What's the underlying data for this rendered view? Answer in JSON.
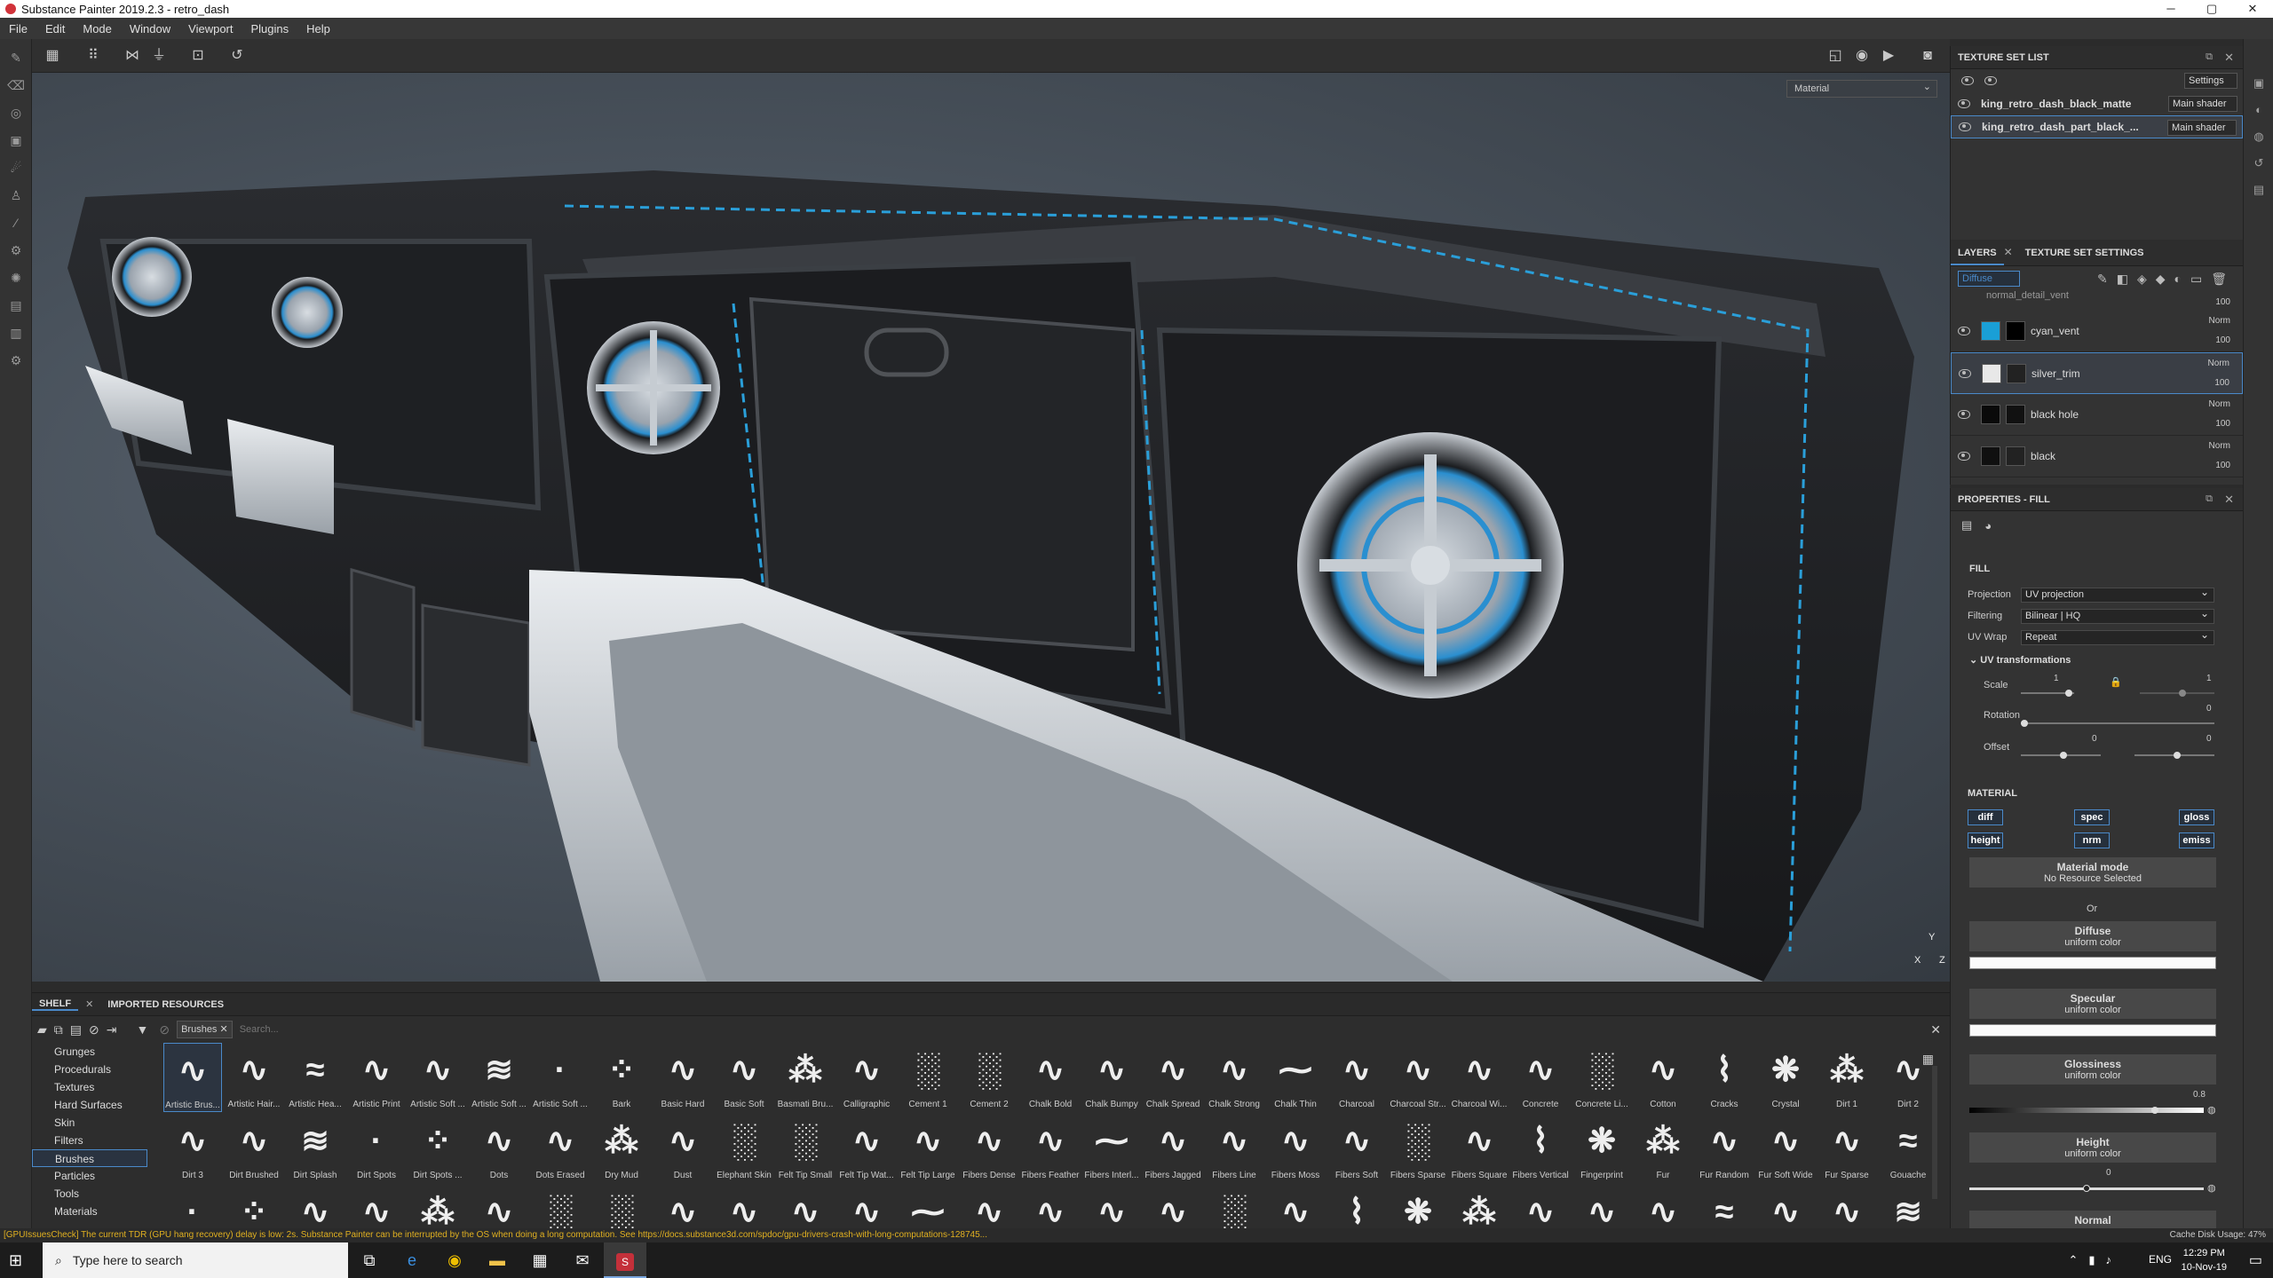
{
  "window": {
    "title": "Substance Painter 2019.2.3 - retro_dash",
    "btn_min": "─",
    "btn_max": "▢",
    "btn_close": "✕"
  },
  "menu": [
    "File",
    "Edit",
    "Mode",
    "Window",
    "Viewport",
    "Plugins",
    "Help"
  ],
  "viewport": {
    "material_mode": "Material",
    "axis_y": "Y",
    "axis_x": "X",
    "axis_z": "Z"
  },
  "texture_set_list": {
    "title": "TEXTURE SET LIST",
    "settings": "Settings",
    "sets": [
      {
        "name": "king_retro_dash_black_matte",
        "shader": "Main shader"
      },
      {
        "name": "king_retro_dash_part_black_...",
        "shader": "Main shader"
      }
    ]
  },
  "layers": {
    "tab_layers": "LAYERS",
    "tab_tss": "TEXTURE SET SETTINGS",
    "channel": "Diffuse",
    "partial_name": "normal_detail_vent",
    "partial_opacity": "100",
    "items": [
      {
        "name": "cyan_vent",
        "blend": "Norm",
        "opacity": "100",
        "color": "#1a9fd6"
      },
      {
        "name": "silver_trim",
        "blend": "Norm",
        "opacity": "100",
        "color": "#e8e8e8"
      },
      {
        "name": "black hole",
        "blend": "Norm",
        "opacity": "100",
        "color": "#0a0a0a"
      },
      {
        "name": "black",
        "blend": "Norm",
        "opacity": "100",
        "color": "#101010"
      }
    ]
  },
  "properties": {
    "title": "PROPERTIES - FILL",
    "fill": "FILL",
    "projection_label": "Projection",
    "projection": "UV projection",
    "filtering_label": "Filtering",
    "filtering": "Bilinear | HQ",
    "uvwrap_label": "UV Wrap",
    "uvwrap": "Repeat",
    "uvt": "UV transformations",
    "scale_label": "Scale",
    "scale_val": "1",
    "scale_val2": "1",
    "rotation_label": "Rotation",
    "rotation_val": "0",
    "offset_label": "Offset",
    "offset_val1": "0",
    "offset_val2": "0",
    "material": "MATERIAL",
    "channels": [
      "diff",
      "spec",
      "gloss",
      "height",
      "nrm",
      "emiss"
    ],
    "material_mode": "Material mode",
    "no_resource": "No Resource Selected",
    "or": "Or",
    "diffuse": "Diffuse",
    "uniform": "uniform color",
    "specular": "Specular",
    "glossiness": "Glossiness",
    "gloss_val": "0.8",
    "height": "Height",
    "height_val": "0",
    "normal": "Normal"
  },
  "shelf": {
    "tab_shelf": "SHELF",
    "tab_imported": "IMPORTED RESOURCES",
    "filter_tag": "Brushes",
    "search_placeholder": "Search...",
    "categories": [
      "Grunges",
      "Procedurals",
      "Textures",
      "Hard Surfaces",
      "Skin",
      "Filters",
      "Brushes",
      "Particles",
      "Tools",
      "Materials"
    ],
    "selected_category": "Brushes",
    "row1": [
      "Artistic Brus...",
      "Artistic Hair...",
      "Artistic Hea...",
      "Artistic Print",
      "Artistic Soft ...",
      "Artistic Soft ...",
      "Artistic Soft ...",
      "Bark",
      "Basic Hard",
      "Basic Soft",
      "Basmati Bru...",
      "Calligraphic",
      "Cement 1",
      "Cement 2",
      "Chalk Bold",
      "Chalk Bumpy",
      "Chalk Spread",
      "Chalk Strong",
      "Chalk Thin",
      "Charcoal",
      "Charcoal Str...",
      "Charcoal Wi...",
      "Concrete",
      "Concrete Li...",
      "Cotton",
      "Cracks",
      "Crystal",
      "Dirt 1",
      "Dirt 2"
    ],
    "row2": [
      "Dirt 3",
      "Dirt Brushed",
      "Dirt Splash",
      "Dirt Spots",
      "Dirt Spots ...",
      "Dots",
      "Dots Erased",
      "Dry Mud",
      "Dust",
      "Elephant Skin",
      "Felt Tip Small",
      "Felt Tip Wat...",
      "Felt Tip Large",
      "Fibers Dense",
      "Fibers Feather",
      "Fibers Interl...",
      "Fibers Jagged",
      "Fibers Line",
      "Fibers Moss",
      "Fibers Soft",
      "Fibers Sparse",
      "Fibers Square",
      "Fibers Vertical",
      "Fingerprint",
      "Fur",
      "Fur Random",
      "Fur Soft Wide",
      "Fur Sparse",
      "Gouache"
    ]
  },
  "status": {
    "message": "[GPUIssuesCheck] The current TDR (GPU hang recovery) delay is low: 2s. Substance Painter can be interrupted by the OS when doing a long computation. See https://docs.substance3d.com/spdoc/gpu-drivers-crash-with-long-computations-128745...",
    "cache": "Cache Disk Usage:",
    "cache_val": "47%"
  },
  "taskbar": {
    "search": "Type here to search",
    "time": "12:29 PM",
    "date": "10-Nov-19",
    "lang": "ENG"
  }
}
